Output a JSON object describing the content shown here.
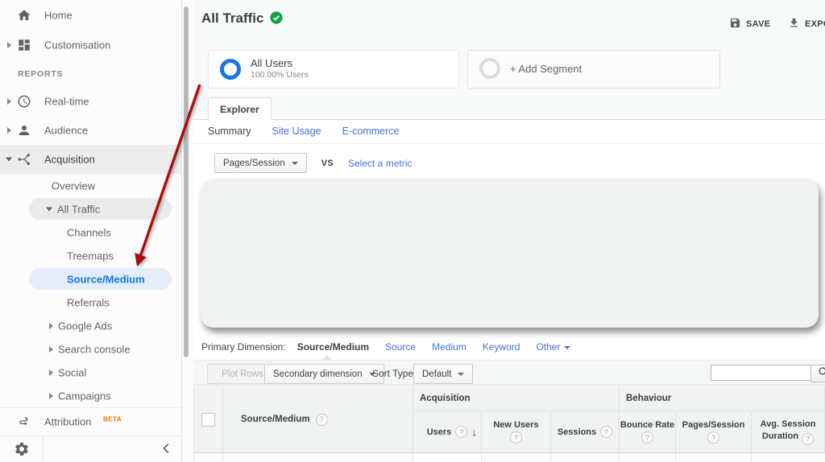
{
  "sidebar": {
    "reports_label": "REPORTS",
    "items": {
      "home": "Home",
      "customisation": "Customisation",
      "realtime": "Real-time",
      "audience": "Audience",
      "acquisition": "Acquisition",
      "overview": "Overview",
      "all_traffic": "All Traffic",
      "channels": "Channels",
      "treemaps": "Treemaps",
      "source_medium": "Source/Medium",
      "referrals": "Referrals",
      "google_ads": "Google Ads",
      "search_console": "Search console",
      "social": "Social",
      "campaigns": "Campaigns",
      "attribution": "Attribution"
    },
    "beta_badge": "BETA"
  },
  "header": {
    "title": "All Traffic",
    "save": "SAVE",
    "export": "EXPORT"
  },
  "segments": {
    "all_users_title": "All Users",
    "all_users_subtitle": "100.00% Users",
    "add_segment": "+ Add Segment"
  },
  "explorer": {
    "tab": "Explorer",
    "summary": "Summary",
    "site_usage": "Site Usage",
    "ecommerce": "E-commerce",
    "metric_selected": "Pages/Session",
    "vs": "VS",
    "select_metric": "Select a metric"
  },
  "primary_dimension": {
    "label": "Primary Dimension:",
    "active": "Source/Medium",
    "source": "Source",
    "medium": "Medium",
    "keyword": "Keyword",
    "other": "Other"
  },
  "toolbar": {
    "plot_rows": "Plot Rows",
    "secondary_dimension": "Secondary dimension",
    "sort_type_label": "Sort Type:",
    "sort_type_value": "Default",
    "search_value": ""
  },
  "table": {
    "dimension_header": "Source/Medium",
    "groups": {
      "acquisition": "Acquisition",
      "behaviour": "Behaviour"
    },
    "columns": {
      "users": "Users",
      "new_users": "New Users",
      "sessions": "Sessions",
      "bounce_rate": "Bounce Rate",
      "pages_session": "Pages/Session",
      "avg_session_duration": "Avg. Session Duration"
    }
  },
  "colors": {
    "accent_blue": "#1a73e8",
    "active_item_bg": "#e4eefb",
    "link_blue": "#4272d9",
    "arrow_red": "#a80f0f",
    "beta_orange": "#e8710a",
    "badge_green": "#12a347"
  }
}
